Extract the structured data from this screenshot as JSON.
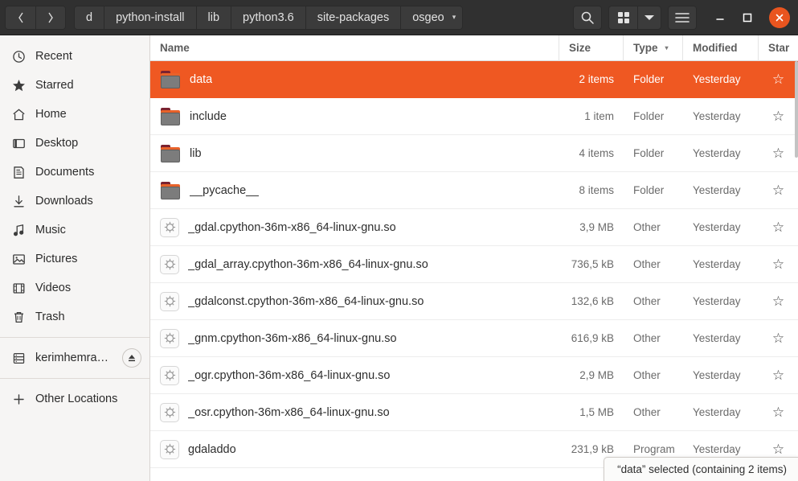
{
  "window": {
    "nav": {
      "back_label": "‹",
      "forward_label": "›"
    },
    "breadcrumbs": [
      {
        "label": "d"
      },
      {
        "label": "python-install"
      },
      {
        "label": "lib"
      },
      {
        "label": "python3.6"
      },
      {
        "label": "site-packages"
      },
      {
        "label": "osgeo"
      }
    ],
    "breadcrumb_caret": "▾",
    "toolbar": {
      "search_label": "search-icon",
      "view_grid_label": "grid-view-icon",
      "view_caret_label": "▾",
      "menu_label": "hamburger-menu-icon"
    },
    "controls": {
      "minimize_label": "—",
      "maximize_label": "□",
      "close_label": "✕"
    }
  },
  "sidebar": {
    "items": [
      {
        "label": "Recent",
        "icon": "clock-icon"
      },
      {
        "label": "Starred",
        "icon": "star-icon"
      },
      {
        "label": "Home",
        "icon": "home-icon"
      },
      {
        "label": "Desktop",
        "icon": "desktop-icon"
      },
      {
        "label": "Documents",
        "icon": "document-icon"
      },
      {
        "label": "Downloads",
        "icon": "download-icon"
      },
      {
        "label": "Music",
        "icon": "music-note-icon"
      },
      {
        "label": "Pictures",
        "icon": "picture-icon"
      },
      {
        "label": "Videos",
        "icon": "film-icon"
      },
      {
        "label": "Trash",
        "icon": "trash-icon"
      }
    ],
    "device": {
      "label": "kerimhemra…",
      "icon": "drive-icon",
      "eject": "eject-icon"
    },
    "other_locations": {
      "label": "Other Locations",
      "icon": "plus-icon"
    }
  },
  "filelist": {
    "columns": {
      "name": "Name",
      "size": "Size",
      "type": "Type",
      "modified": "Modified",
      "star": "Star"
    },
    "sort_column": "Type",
    "sort_caret": "▾",
    "star_glyph": "☆",
    "rows": [
      {
        "name": "data",
        "size": "2 items",
        "type": "Folder",
        "modified": "Yesterday",
        "icon": "folder-icon",
        "selected": true
      },
      {
        "name": "include",
        "size": "1 item",
        "type": "Folder",
        "modified": "Yesterday",
        "icon": "folder-icon",
        "selected": false
      },
      {
        "name": "lib",
        "size": "4 items",
        "type": "Folder",
        "modified": "Yesterday",
        "icon": "folder-icon",
        "selected": false
      },
      {
        "name": "__pycache__",
        "size": "8 items",
        "type": "Folder",
        "modified": "Yesterday",
        "icon": "folder-icon",
        "selected": false
      },
      {
        "name": "_gdal.cpython-36m-x86_64-linux-gnu.so",
        "size": "3,9 MB",
        "type": "Other",
        "modified": "Yesterday",
        "icon": "file-icon",
        "selected": false
      },
      {
        "name": "_gdal_array.cpython-36m-x86_64-linux-gnu.so",
        "size": "736,5 kB",
        "type": "Other",
        "modified": "Yesterday",
        "icon": "file-icon",
        "selected": false
      },
      {
        "name": "_gdalconst.cpython-36m-x86_64-linux-gnu.so",
        "size": "132,6 kB",
        "type": "Other",
        "modified": "Yesterday",
        "icon": "file-icon",
        "selected": false
      },
      {
        "name": "_gnm.cpython-36m-x86_64-linux-gnu.so",
        "size": "616,9 kB",
        "type": "Other",
        "modified": "Yesterday",
        "icon": "file-icon",
        "selected": false
      },
      {
        "name": "_ogr.cpython-36m-x86_64-linux-gnu.so",
        "size": "2,9 MB",
        "type": "Other",
        "modified": "Yesterday",
        "icon": "file-icon",
        "selected": false
      },
      {
        "name": "_osr.cpython-36m-x86_64-linux-gnu.so",
        "size": "1,5 MB",
        "type": "Other",
        "modified": "Yesterday",
        "icon": "file-icon",
        "selected": false
      },
      {
        "name": "gdaladdo",
        "size": "231,9 kB",
        "type": "Program",
        "modified": "Yesterday",
        "icon": "file-icon",
        "selected": false
      }
    ]
  },
  "status": {
    "text": "“data” selected  (containing 2 items)"
  },
  "colors": {
    "accent": "#ef5822",
    "headerbar": "#303030",
    "sidebar": "#f6f5f4",
    "close_button": "#e9551f"
  }
}
